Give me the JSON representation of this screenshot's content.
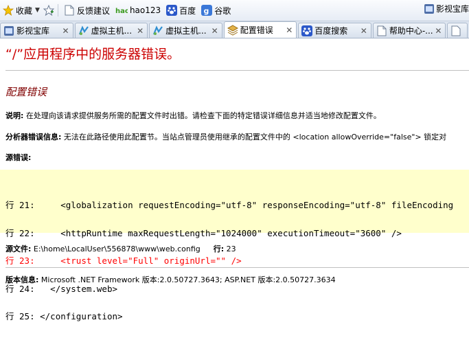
{
  "favbar": {
    "favorites_label": "收藏",
    "items": [
      "反馈建议",
      "hao123",
      "百度",
      "谷歌"
    ],
    "right_label": "影视宝库"
  },
  "tabs": [
    {
      "label": "影视宝库",
      "icon": "video-icon",
      "active": false
    },
    {
      "label": "虚拟主机...",
      "icon": "app-icon",
      "active": false
    },
    {
      "label": "虚拟主机...",
      "icon": "app-icon",
      "active": false
    },
    {
      "label": "配置错误",
      "icon": "page-icon",
      "active": true
    },
    {
      "label": "百度搜索",
      "icon": "baidu-paw-icon",
      "active": false
    },
    {
      "label": "帮助中心-...",
      "icon": "document-icon",
      "active": false
    }
  ],
  "page": {
    "title": "“/”应用程序中的服务器错误。",
    "subtitle": "配置错误",
    "desc_label": "说明:",
    "desc_text": " 在处理向该请求提供服务所需的配置文件时出错。请检查下面的特定错误详细信息并适当地修改配置文件。",
    "parser_label": "分析器错误信息:",
    "parser_text": " 无法在此路径使用此配置节。当站点管理员使用继承的配置文件中的 <location allowOverride=\"false\"> 锁定对",
    "source_error_label": "源错误:",
    "code_lines": [
      {
        "text": "行 21:     <globalization requestEncoding=\"utf-8\" responseEncoding=\"utf-8\" fileEncoding",
        "error": false
      },
      {
        "text": "行 22:     <httpRuntime maxRequestLength=\"1024000\" executionTimeout=\"3600\" />",
        "error": false
      },
      {
        "text": "行 23:     <trust level=\"Full\" originUrl=\"\" />",
        "error": true
      },
      {
        "text": "行 24:   </system.web>",
        "error": false
      },
      {
        "text": "行 25: </configuration>",
        "error": false
      }
    ],
    "source_file_label": "源文件:",
    "source_file_path": " E:\\home\\LocalUser\\556878\\www\\web.config",
    "line_label": "行:",
    "line_number": " 23",
    "version_label": "版本信息:",
    "version_text": " Microsoft .NET Framework 版本:2.0.50727.3643; ASP.NET 版本:2.0.50727.3634"
  },
  "colors": {
    "title_red": "#cc0000",
    "subtitle_maroon": "#800000",
    "code_bg": "#ffffcc",
    "error_line_red": "#ff0000"
  }
}
